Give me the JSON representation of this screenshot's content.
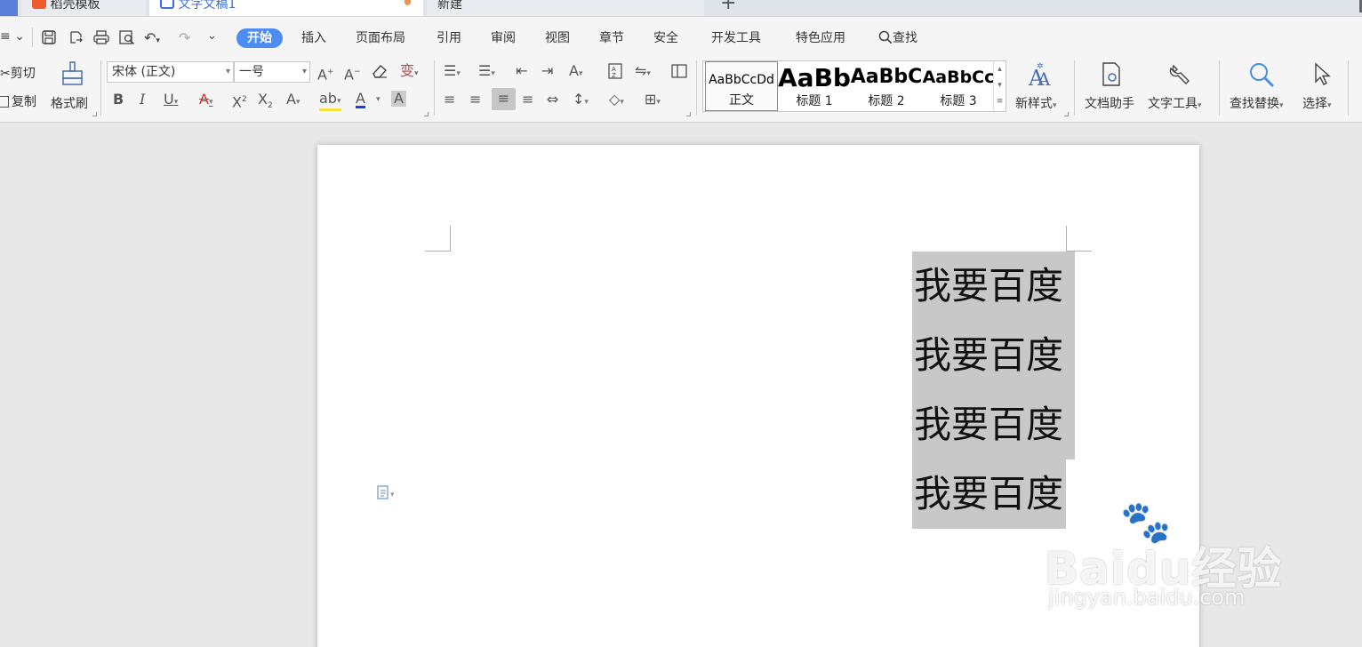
{
  "tabs": [
    {
      "label": "稻壳模板"
    },
    {
      "label": "文字文稿1"
    },
    {
      "label": "新建"
    }
  ],
  "menu": {
    "items": [
      "开始",
      "插入",
      "页面布局",
      "引用",
      "审阅",
      "视图",
      "章节",
      "安全",
      "开发工具",
      "特色应用"
    ],
    "search_label": "查找"
  },
  "ribbon": {
    "cut": "剪切",
    "copy": "复制",
    "format_painter": "格式刷",
    "font_name": "宋体 (正文)",
    "font_size": "一号",
    "styles": [
      {
        "sample": "AaBbCcDd",
        "name": "正文"
      },
      {
        "sample": "AaBb",
        "name": "标题 1"
      },
      {
        "sample": "AaBbC",
        "name": "标题 2"
      },
      {
        "sample": "AaBbCc",
        "name": "标题 3"
      }
    ],
    "new_style": "新样式",
    "doc_assistant": "文档助手",
    "text_tools": "文字工具",
    "find_replace": "查找替换",
    "select": "选择"
  },
  "document": {
    "lines": [
      "我要百度",
      "我要百度",
      "我要百度",
      "我要百度"
    ]
  },
  "watermark": {
    "brand": "Baidu经验",
    "url": "jingyan.baidu.com"
  },
  "colors": {
    "accent": "#4d8df3",
    "selection": "#c8c8c8",
    "active_tab_text": "#3b6fd4"
  }
}
